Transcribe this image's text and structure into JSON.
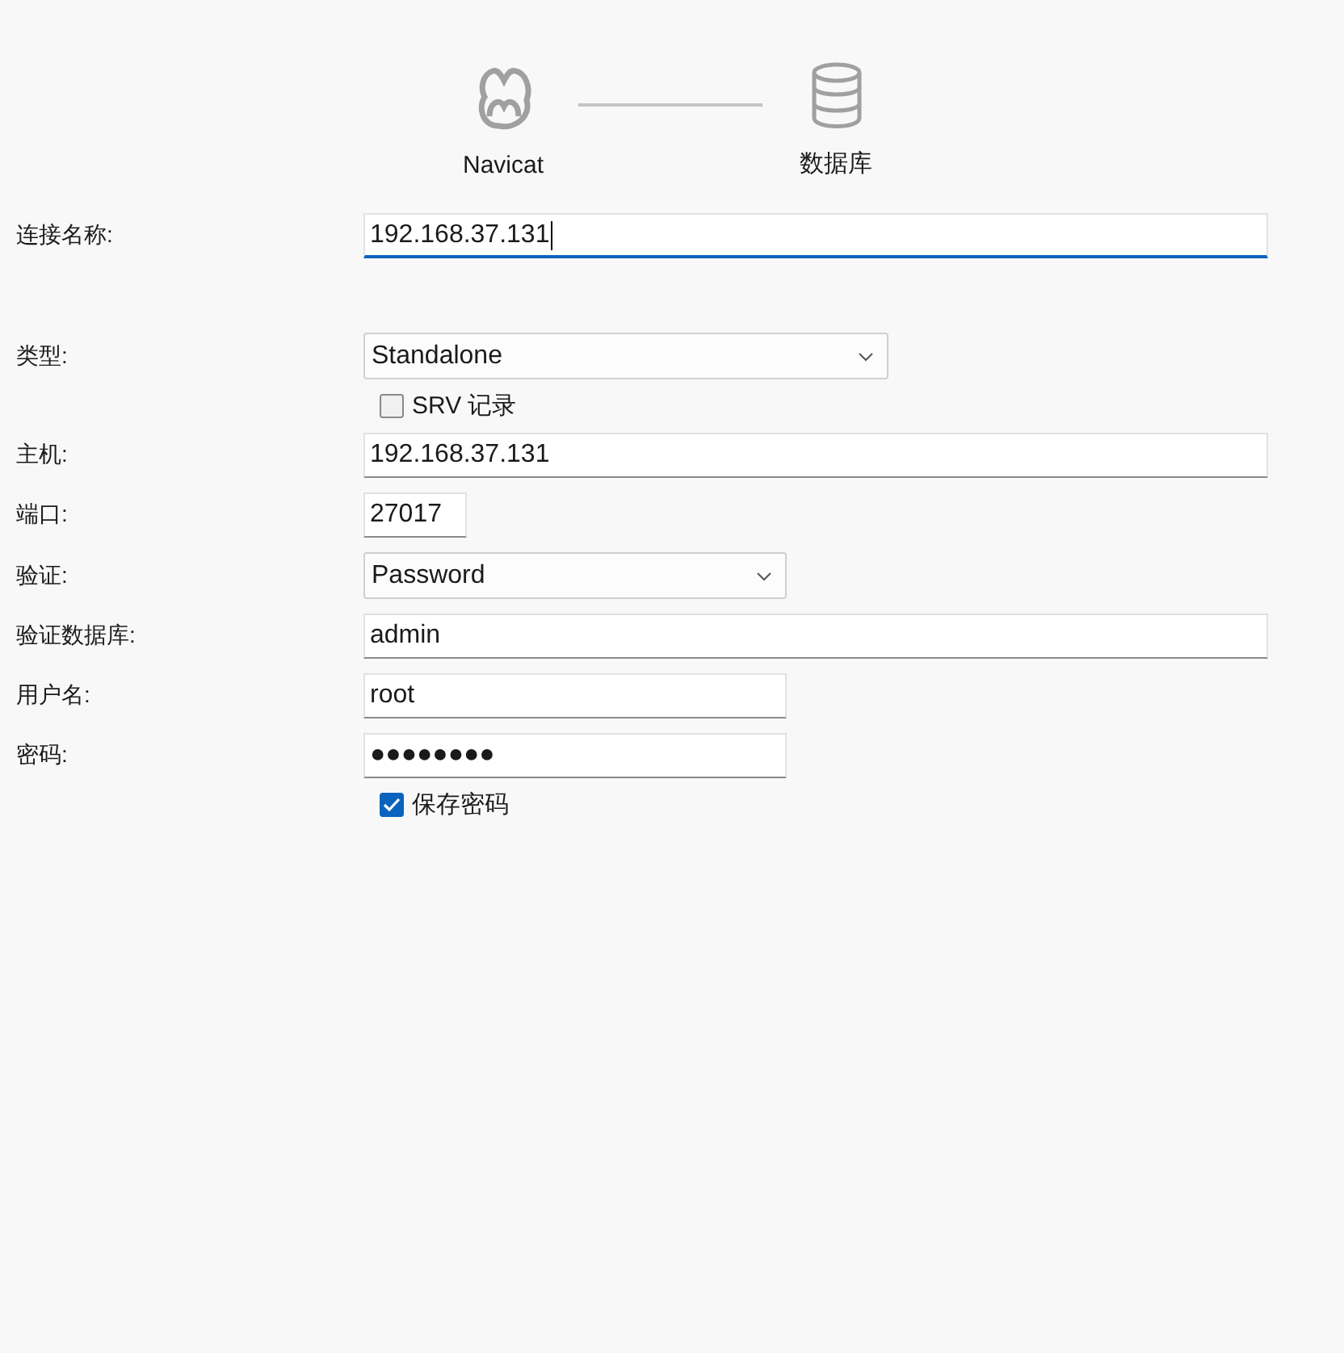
{
  "steps": [
    {
      "label": "Navicat",
      "kind": "navicat"
    },
    {
      "label": "数据库",
      "kind": "database"
    }
  ],
  "fields": [
    {
      "kind": "text",
      "label": "连接名称:",
      "value": "192.168.37.131",
      "focused": true
    },
    {
      "kind": "select",
      "label": "类型:",
      "value": "Standalone"
    },
    {
      "kind": "checkbox",
      "text": "SRV 记录",
      "checked": false
    },
    {
      "kind": "text",
      "label": "主机:",
      "value": "192.168.37.131",
      "focused": false
    },
    {
      "kind": "text",
      "label": "端口:",
      "value": "27017",
      "focused": false
    },
    {
      "kind": "select",
      "label": "验证:",
      "value": "Password"
    },
    {
      "kind": "text",
      "label": "验证数据库:",
      "value": "admin",
      "focused": false
    },
    {
      "kind": "text",
      "label": "用户名:",
      "value": "root",
      "focused": false
    },
    {
      "kind": "text",
      "label": "密码:",
      "value": "●●●●●●●●",
      "focused": false
    },
    {
      "kind": "checkbox",
      "text": "保存密码",
      "checked": true
    }
  ]
}
